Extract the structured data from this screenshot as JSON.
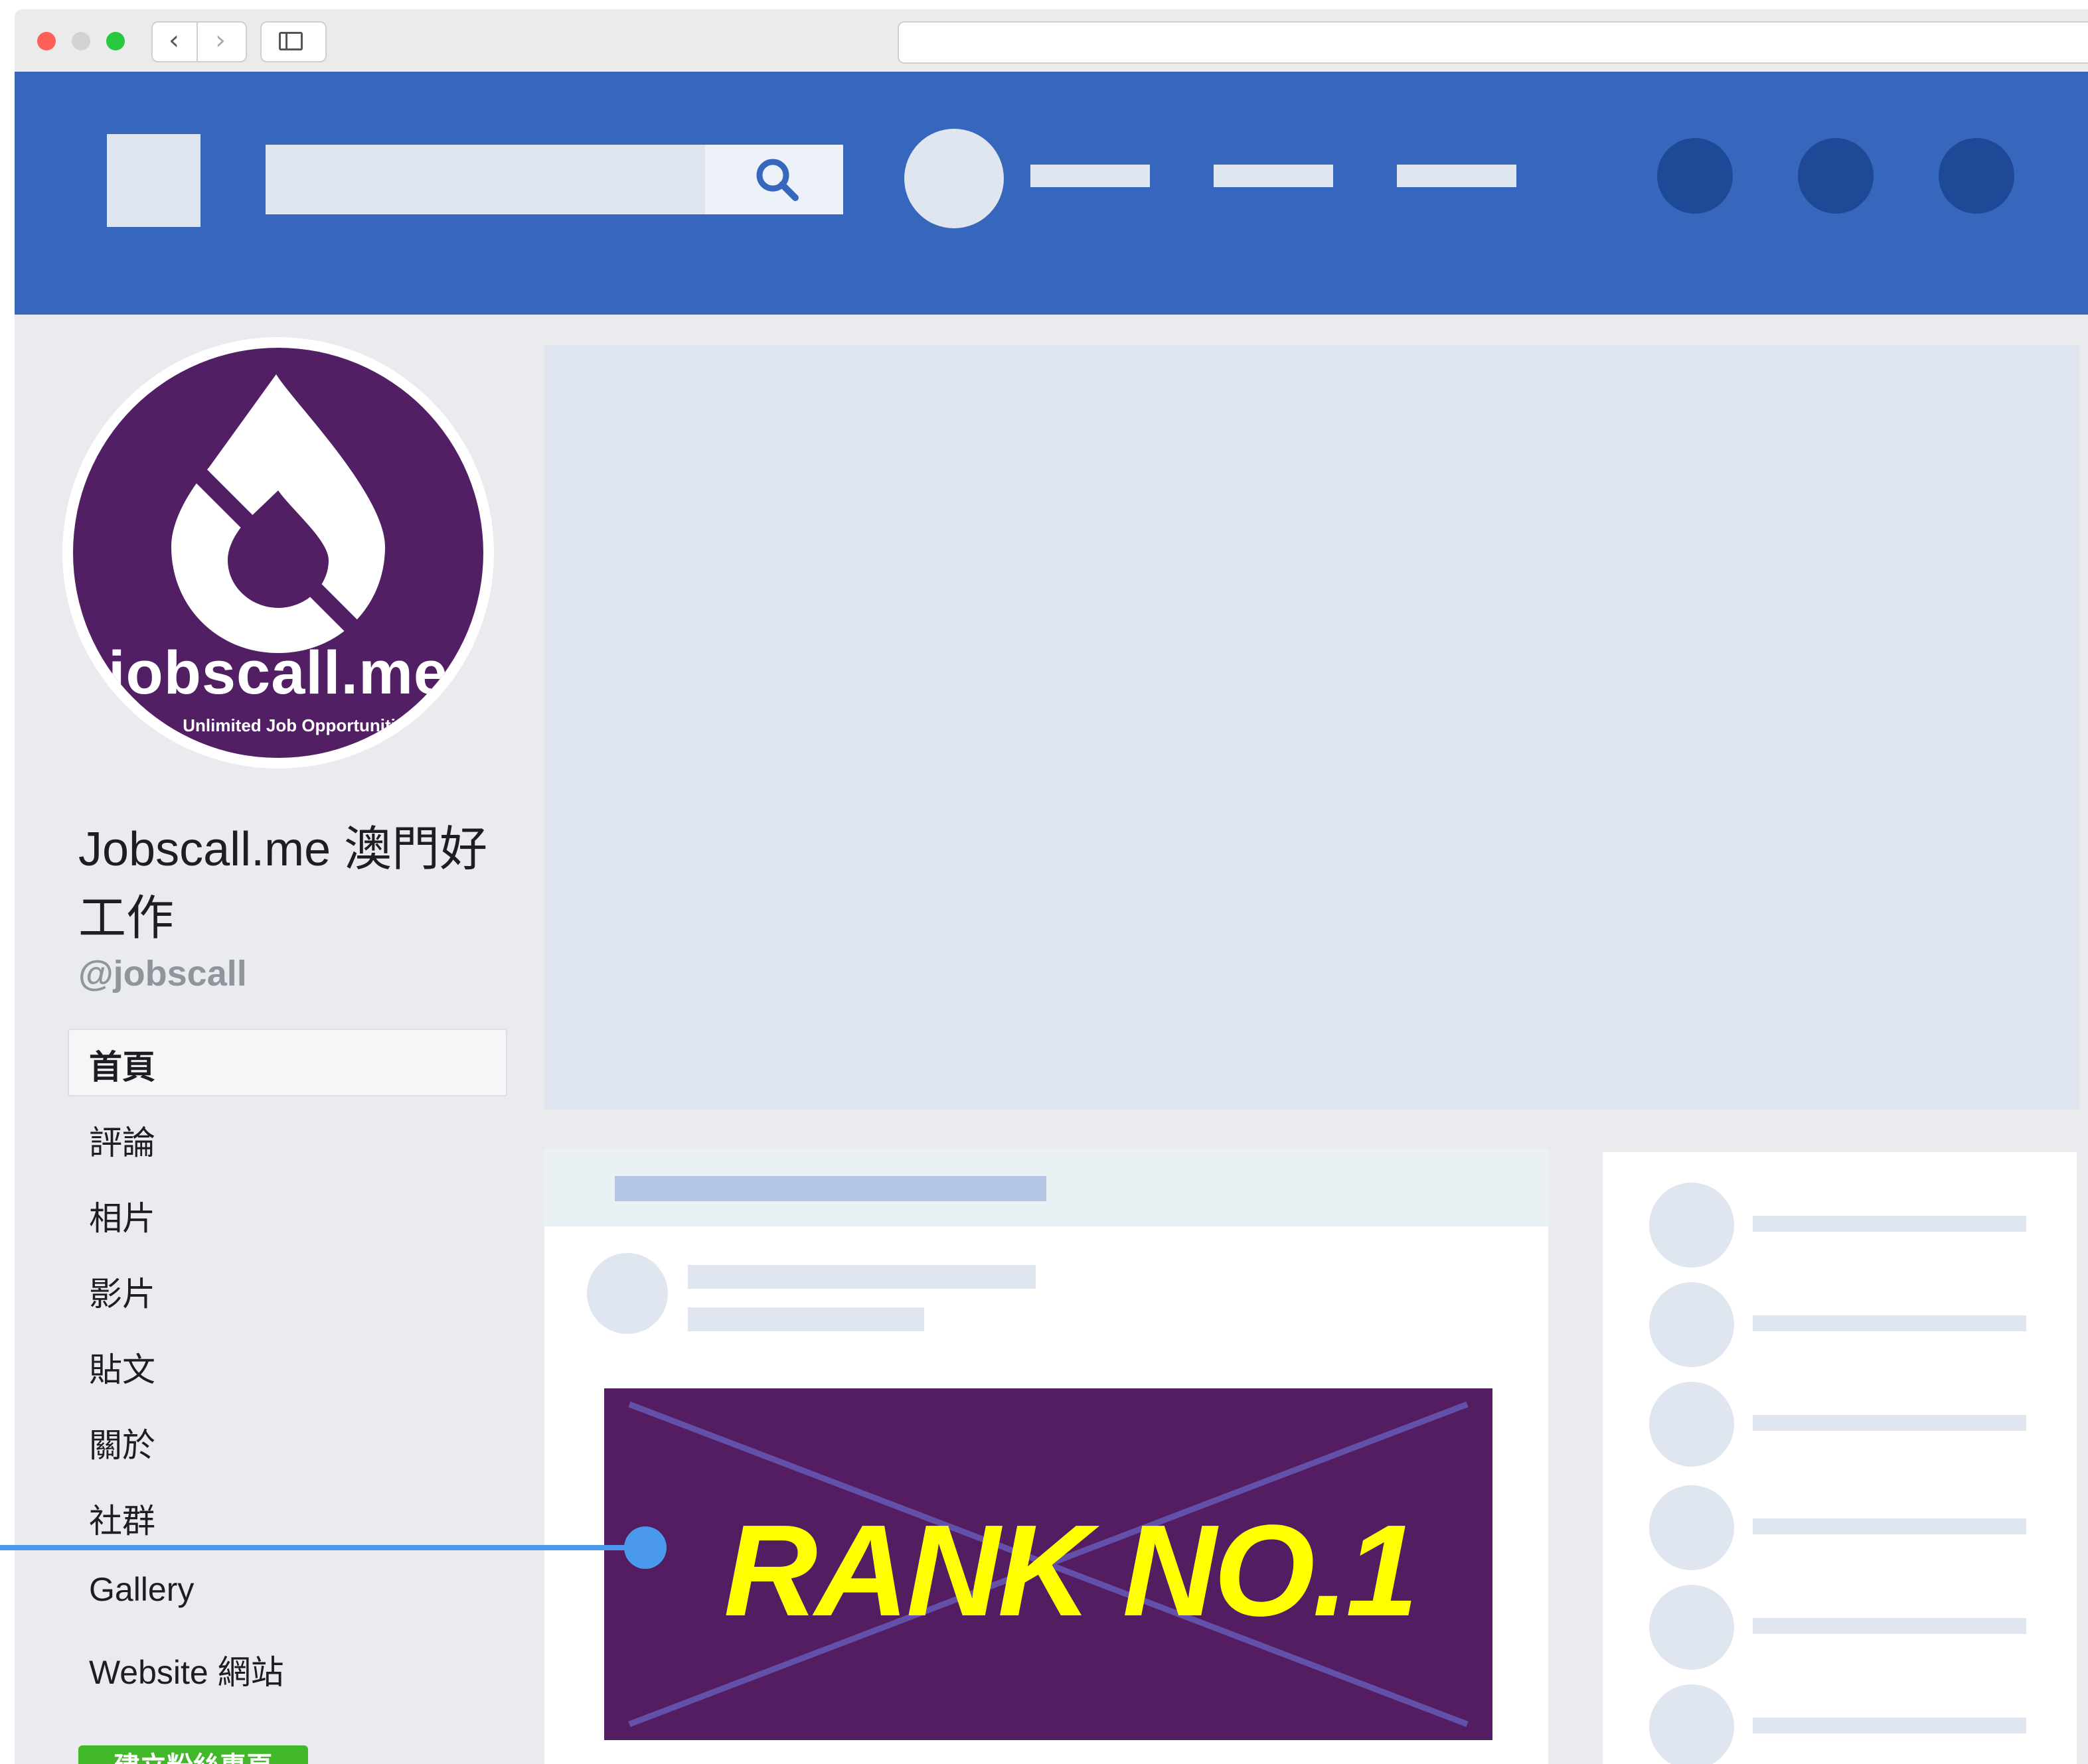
{
  "browser": {
    "back_glyph": "‹",
    "forward_glyph": "›",
    "icons": [
      "back-chevron-icon",
      "forward-chevron-icon",
      "sidebar-toggle-icon"
    ]
  },
  "header": {
    "color": "#3767bd",
    "icons": [
      "search-icon"
    ]
  },
  "profile": {
    "logo": {
      "text": "jobscall.me",
      "tagline": "Unlimited Job Opportunities"
    },
    "title": "Jobscall.me 澳門好工作",
    "handle": "@jobscall"
  },
  "nav": {
    "items": [
      {
        "label": "首頁",
        "active": true
      },
      {
        "label": "評論"
      },
      {
        "label": "相片"
      },
      {
        "label": "影片"
      },
      {
        "label": "貼文"
      },
      {
        "label": "關於"
      },
      {
        "label": "社群"
      },
      {
        "label": "Gallery"
      },
      {
        "label": "Website 網站"
      }
    ],
    "create_page_button": "建立粉絲專頁"
  },
  "post": {
    "image_text": "RANK NO.1",
    "image_bg": "#541c61",
    "text_color": "#ffff00"
  },
  "annotation": {
    "color": "#4a99ec"
  }
}
